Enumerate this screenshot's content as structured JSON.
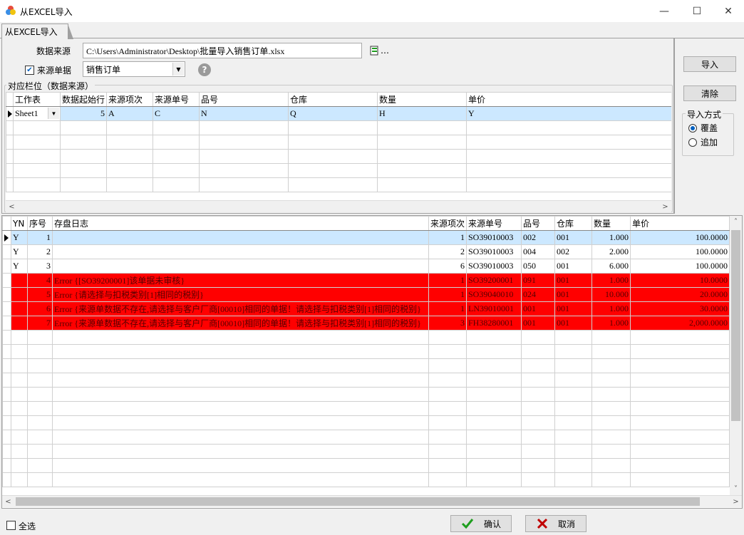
{
  "window": {
    "title": "从EXCEL导入",
    "minimize": "—",
    "maximize": "☐",
    "close": "✕"
  },
  "tab": {
    "label": "从EXCEL导入"
  },
  "source": {
    "data_source_label": "数据来源",
    "file_path": "C:\\Users\\Administrator\\Desktop\\批量导入销售订单.xlsx",
    "browse_glyph": "…",
    "source_doc_label": "来源单据",
    "source_doc_checked": true,
    "source_doc_value": "销售订单",
    "help_glyph": "?"
  },
  "mapping": {
    "group_title": "对应栏位（数据来源）",
    "columns": [
      "工作表",
      "数据起始行",
      "来源项次",
      "来源单号",
      "品号",
      "仓库",
      "数量",
      "单价"
    ],
    "row": {
      "sheet": "Sheet1",
      "start_row": "5",
      "source_item": "A",
      "source_no": "C",
      "item_no": "N",
      "warehouse": "Q",
      "qty": "H",
      "price": "Y"
    }
  },
  "side": {
    "import_button": "导入",
    "clear_button": "清除",
    "mode_group": "导入方式",
    "mode_overwrite": "覆盖",
    "mode_append": "追加",
    "selected_mode": "overwrite"
  },
  "result": {
    "columns": [
      "YN",
      "序号",
      "存盘日志",
      "来源项次",
      "来源单号",
      "品号",
      "仓库",
      "数量",
      "单价"
    ],
    "rows": [
      {
        "yn": "Y",
        "seq": "1",
        "log": "",
        "src_item": "1",
        "src_no": "SO39010003",
        "item": "002",
        "wh": "001",
        "qty": "1.000",
        "price": "100.0000",
        "status": "selected"
      },
      {
        "yn": "Y",
        "seq": "2",
        "log": "",
        "src_item": "2",
        "src_no": "SO39010003",
        "item": "004",
        "wh": "002",
        "qty": "2.000",
        "price": "100.0000",
        "status": "ok"
      },
      {
        "yn": "Y",
        "seq": "3",
        "log": "",
        "src_item": "6",
        "src_no": "SO39010003",
        "item": "050",
        "wh": "001",
        "qty": "6.000",
        "price": "100.0000",
        "status": "ok"
      },
      {
        "yn": "",
        "seq": "4",
        "log": "Error {[SO39200001]该单据未审核}",
        "src_item": "1",
        "src_no": "SO39200001",
        "item": "091",
        "wh": "001",
        "qty": "1.000",
        "price": "10.0000",
        "status": "error"
      },
      {
        "yn": "",
        "seq": "5",
        "log": "Error {请选择与扣税类别[1]相同的税别}",
        "src_item": "1",
        "src_no": "SO39040010",
        "item": "024",
        "wh": "001",
        "qty": "10.000",
        "price": "20.0000",
        "status": "error"
      },
      {
        "yn": "",
        "seq": "6",
        "log": "Error {来源单数据不存在,请选择与客户厂商[00010]相同的单据！请选择与扣税类别[1]相同的税别}",
        "src_item": "1",
        "src_no": "LN39010001",
        "item": "001",
        "wh": "001",
        "qty": "1.000",
        "price": "30.0000",
        "status": "error"
      },
      {
        "yn": "",
        "seq": "7",
        "log": "Error {来源单数据不存在,请选择与客户厂商[00010]相同的单据！请选择与扣税类别[1]相同的税别}",
        "src_item": "3",
        "src_no": "FH38280001",
        "item": "001",
        "wh": "001",
        "qty": "1.000",
        "price": "2,000.0000",
        "status": "error"
      }
    ]
  },
  "footer": {
    "select_all_label": "全选",
    "confirm_button": "确认",
    "cancel_button": "取消"
  },
  "colors": {
    "error_row": "#ff0000",
    "selected_row": "#cce8ff",
    "confirm_check": "#1e9e1e",
    "cancel_x": "#c00000"
  }
}
